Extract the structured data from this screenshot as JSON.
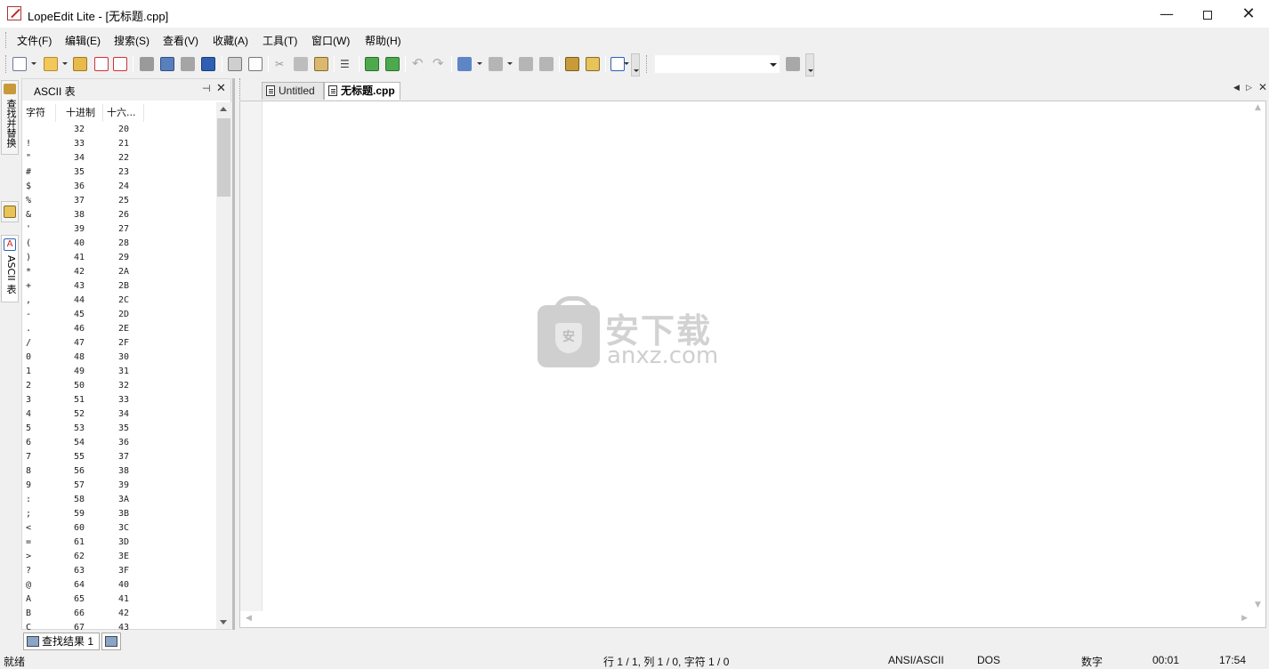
{
  "window": {
    "title": "LopeEdit Lite - [无标题.cpp]",
    "minimize": "—",
    "close": "✕"
  },
  "menu": [
    "文件(F)",
    "编辑(E)",
    "搜索(S)",
    "查看(V)",
    "收藏(A)",
    "工具(T)",
    "窗口(W)",
    "帮助(H)"
  ],
  "toolbar": {
    "icons": [
      "new-file-icon",
      "open-file-icon",
      "open-folder-icon",
      "close-file-icon",
      "close-all-icon",
      "save-disabled-icon",
      "save-as-icon",
      "save-copy-icon",
      "save-all-icon",
      "print-icon",
      "print-preview-icon",
      "cut-icon",
      "copy-icon",
      "paste-icon",
      "align-icon",
      "indent-icon",
      "outdent-icon",
      "undo-icon",
      "redo-icon",
      "bookmark-icon",
      "bookmark-prev-icon",
      "bookmark-next-icon",
      "bookmark-clear-icon",
      "find-icon",
      "replace-icon",
      "goto-icon",
      "run-icon"
    ],
    "combo_value": ""
  },
  "side_tabs": {
    "find_replace": "查找并替换",
    "ascii": "ASCII 表"
  },
  "ascii_panel": {
    "title": "ASCII 表",
    "pin": "⊣",
    "close": "✕",
    "headers": [
      "字符",
      "十进制",
      "十六..."
    ],
    "rows": [
      [
        "",
        "32",
        "20"
      ],
      [
        "!",
        "33",
        "21"
      ],
      [
        "\"",
        "34",
        "22"
      ],
      [
        "#",
        "35",
        "23"
      ],
      [
        "$",
        "36",
        "24"
      ],
      [
        "%",
        "37",
        "25"
      ],
      [
        "&",
        "38",
        "26"
      ],
      [
        "'",
        "39",
        "27"
      ],
      [
        "(",
        "40",
        "28"
      ],
      [
        ")",
        "41",
        "29"
      ],
      [
        "*",
        "42",
        "2A"
      ],
      [
        "+",
        "43",
        "2B"
      ],
      [
        ",",
        "44",
        "2C"
      ],
      [
        "-",
        "45",
        "2D"
      ],
      [
        ".",
        "46",
        "2E"
      ],
      [
        "/",
        "47",
        "2F"
      ],
      [
        "0",
        "48",
        "30"
      ],
      [
        "1",
        "49",
        "31"
      ],
      [
        "2",
        "50",
        "32"
      ],
      [
        "3",
        "51",
        "33"
      ],
      [
        "4",
        "52",
        "34"
      ],
      [
        "5",
        "53",
        "35"
      ],
      [
        "6",
        "54",
        "36"
      ],
      [
        "7",
        "55",
        "37"
      ],
      [
        "8",
        "56",
        "38"
      ],
      [
        "9",
        "57",
        "39"
      ],
      [
        ":",
        "58",
        "3A"
      ],
      [
        ";",
        "59",
        "3B"
      ],
      [
        "<",
        "60",
        "3C"
      ],
      [
        "=",
        "61",
        "3D"
      ],
      [
        ">",
        "62",
        "3E"
      ],
      [
        "?",
        "63",
        "3F"
      ],
      [
        "@",
        "64",
        "40"
      ],
      [
        "A",
        "65",
        "41"
      ],
      [
        "B",
        "66",
        "42"
      ],
      [
        "C",
        "67",
        "43"
      ]
    ]
  },
  "doc_tabs": {
    "items": [
      "Untitled",
      "无标题.cpp"
    ],
    "active_index": 1
  },
  "watermark": {
    "cn": "安下载",
    "en": "anxz.com",
    "shield": "安"
  },
  "bottom_tabs": {
    "find_results": "查找结果 1"
  },
  "status": {
    "ready": "就绪",
    "position": "行 1 / 1, 列 1 / 0, 字符 1 / 0",
    "encoding": "ANSI/ASCII",
    "line_ending": "DOS",
    "num_lock": "数字",
    "elapsed": "00:01",
    "clock": "17:54"
  },
  "colors": {
    "chrome": "#f0f0f0",
    "editor_bg": "#ffffff",
    "watermark": "#d2d2d2"
  }
}
